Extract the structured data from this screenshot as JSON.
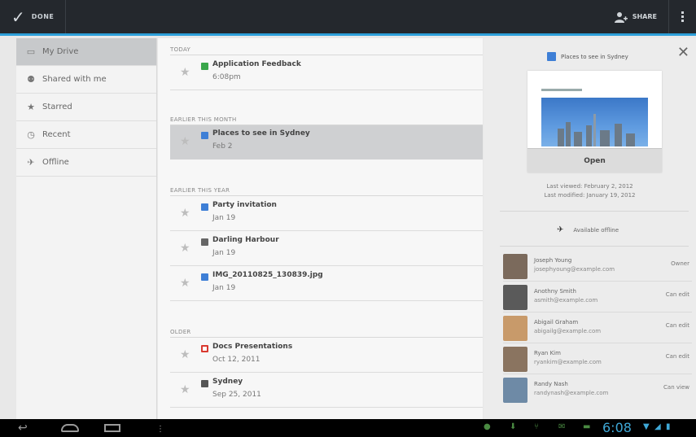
{
  "actionbar": {
    "done_label": "DONE",
    "share_label": "SHARE"
  },
  "sidebar": {
    "items": [
      {
        "label": "My Drive",
        "icon": "drive-icon",
        "active": true
      },
      {
        "label": "Shared with me",
        "icon": "people-icon",
        "active": false
      },
      {
        "label": "Starred",
        "icon": "star-icon",
        "active": false
      },
      {
        "label": "Recent",
        "icon": "clock-icon",
        "active": false
      },
      {
        "label": "Offline",
        "icon": "pin-icon",
        "active": false
      }
    ]
  },
  "list": {
    "sections": [
      {
        "heading": "TODAY"
      },
      {
        "heading": "EARLIER THIS MONTH"
      },
      {
        "heading": "EARLIER THIS YEAR"
      },
      {
        "heading": "OLDER"
      }
    ],
    "files": [
      {
        "name": "Application Feedback",
        "date": "6:08pm",
        "type": "spreadsheet",
        "color": "#3aa64b"
      },
      {
        "name": "Places to see in Sydney",
        "date": "Feb 2",
        "type": "document",
        "color": "#3e7fd6"
      },
      {
        "name": "Party invitation",
        "date": "Jan 19",
        "type": "document",
        "color": "#3e7fd6"
      },
      {
        "name": "Darling Harbour",
        "date": "Jan 19",
        "type": "calendar",
        "color": "#666666"
      },
      {
        "name": "IMG_20110825_130839.jpg",
        "date": "Jan 19",
        "type": "image",
        "color": "#3e7fd6"
      },
      {
        "name": "Docs Presentations",
        "date": "Oct 12, 2011",
        "type": "presentation",
        "color": "#d9392f"
      },
      {
        "name": "Sydney",
        "date": "Sep 25, 2011",
        "type": "folder",
        "color": "#555555"
      }
    ]
  },
  "details": {
    "title": "Places to see in Sydney",
    "open_label": "Open",
    "last_viewed": "Last viewed: February 2, 2012",
    "last_modified": "Last modified: January 19, 2012",
    "offline_label": "Available offline",
    "people": [
      {
        "name": "Joseph Young",
        "email": "josephyoung@example.com",
        "role": "Owner",
        "avatar": "#7b6a5c"
      },
      {
        "name": "Anothny Smith",
        "email": "asmith@example.com",
        "role": "Can edit",
        "avatar": "#5a5a5a"
      },
      {
        "name": "Abigail Graham",
        "email": "abigailg@example.com",
        "role": "Can edit",
        "avatar": "#c89a6a"
      },
      {
        "name": "Ryan Kim",
        "email": "ryankim@example.com",
        "role": "Can edit",
        "avatar": "#8a7460"
      },
      {
        "name": "Randy Nash",
        "email": "randynash@example.com",
        "role": "Can view",
        "avatar": "#6e8aa6"
      }
    ]
  },
  "systembar": {
    "time": "6:08"
  }
}
